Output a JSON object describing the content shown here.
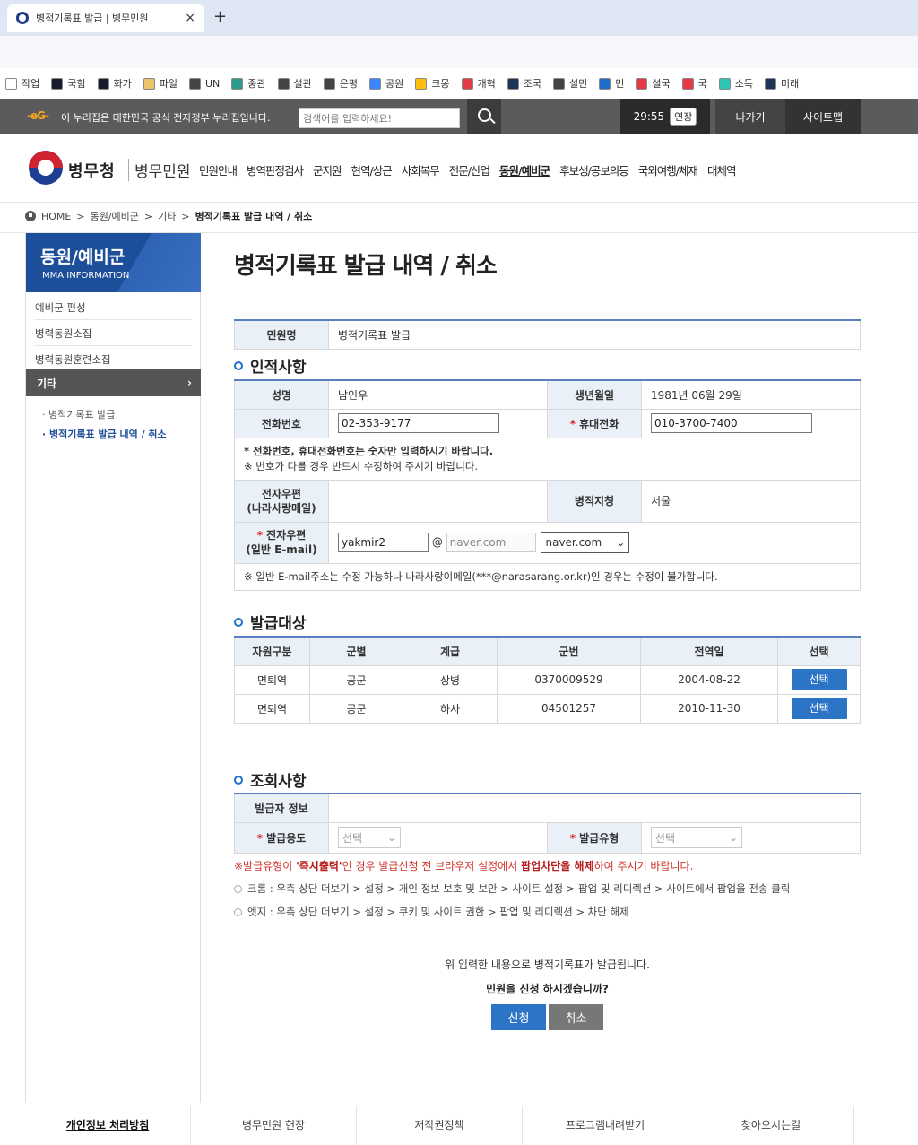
{
  "browser": {
    "tab_title": "병적기록표 발급 | 병무민원",
    "tab_close": "×",
    "new_tab": "+",
    "bookmarks": [
      {
        "label": "작업",
        "color": "#ffffff"
      },
      {
        "label": "국힘",
        "color": "#1a1a2e"
      },
      {
        "label": "화가",
        "color": "#1a1a2e"
      },
      {
        "label": "파일",
        "color": "#e9c46a"
      },
      {
        "label": "UN",
        "color": "#444444"
      },
      {
        "label": "중관",
        "color": "#2a9d8f"
      },
      {
        "label": "설관",
        "color": "#444444"
      },
      {
        "label": "은평",
        "color": "#444444"
      },
      {
        "label": "공원",
        "color": "#3a86ff"
      },
      {
        "label": "크몽",
        "color": "#ffbe0b"
      },
      {
        "label": "개혁",
        "color": "#e63946"
      },
      {
        "label": "조국",
        "color": "#1d3557"
      },
      {
        "label": "설민",
        "color": "#444444"
      },
      {
        "label": "민",
        "color": "#1d6fc9"
      },
      {
        "label": "설국",
        "color": "#e63946"
      },
      {
        "label": "국",
        "color": "#e63946"
      },
      {
        "label": "소득",
        "color": "#2ec4b6"
      },
      {
        "label": "미래",
        "color": "#1d3557"
      }
    ]
  },
  "gov": {
    "logo": "-eG-",
    "text": "이 누리집은 대한민국 공식 전자정부 누리집입니다.",
    "search_placeholder": "검색어를 입력하세요!",
    "timer": "29:55",
    "extend": "연장",
    "logout": "나가기",
    "sitemap": "사이트맵"
  },
  "header": {
    "brand": "병무청",
    "brand2": "병무민원",
    "gnb": [
      "민원안내",
      "병역판정검사",
      "군지원",
      "현역/상근",
      "사회복무",
      "전문/산업",
      "동원/예비군",
      "후보생/공보의등",
      "국외여행/체재",
      "대체역"
    ],
    "active_gnb": "동원/예비군"
  },
  "breadcrumb": {
    "home": "HOME",
    "items": [
      "동원/예비군",
      "기타"
    ],
    "current": "병적기록표 발급 내역 / 취소",
    "sep": ">"
  },
  "lnav": {
    "title": "동원/예비군",
    "subtitle": "MMA INFORMATION",
    "items": [
      "예비군 편성",
      "병력동원소집",
      "병력동원훈련소집"
    ],
    "active": "기타",
    "active_arrow": "›",
    "subs": [
      "병적기록표 발급",
      "병적기록표 발급 내역 / 취소"
    ]
  },
  "page": {
    "title": "병적기록표 발급 내역 / 취소",
    "civil_label": "민원명",
    "civil_value": "병적기록표 발급"
  },
  "personal": {
    "section": "인적사항",
    "name_label": "성명",
    "name": "남인우",
    "birth_label": "생년월일",
    "birth": "1981년 06월 29일",
    "phone_label": "전화번호",
    "phone": "02-353-9177",
    "mobile_label": "휴대전화",
    "mobile": "010-3700-7400",
    "note1": "* 전화번호, 휴대전화번호는 숫자만 입력하시기 바랍니다.",
    "note2": "※ 번호가 다를 경우 반드시 수정하여 주시기 바랍니다.",
    "email1_label1": "전자우편",
    "email1_label2": "(나라사랑메일)",
    "office_label": "병적지청",
    "office": "서울",
    "email2_label1": "전자우편",
    "email2_label2": "(일반 E-mail)",
    "email_id": "yakmir2",
    "at": "@",
    "email_domain": "naver.com",
    "email_select": "naver.com",
    "email_note": "※ 일반 E-mail주소는 수정 가능하나 나라사랑이메일(***@narasarang.or.kr)인 경우는 수정이 불가합니다."
  },
  "target": {
    "section": "발급대상",
    "headers": [
      "자원구분",
      "군별",
      "계급",
      "군번",
      "전역일",
      "선택"
    ],
    "rows": [
      {
        "type": "면퇴역",
        "branch": "공군",
        "rank": "상병",
        "number": "0370009529",
        "date": "2004-08-22",
        "btn": "선택"
      },
      {
        "type": "면퇴역",
        "branch": "공군",
        "rank": "하사",
        "number": "04501257",
        "date": "2010-11-30",
        "btn": "선택"
      }
    ]
  },
  "query": {
    "section": "조회사항",
    "issuer_label": "발급자 정보",
    "purpose_label": "발급용도",
    "purpose": "선택",
    "kind_label": "발급유형",
    "kind": "선택",
    "warn_pre": "※발급유형이 ",
    "warn_b1": "'즉시출력'",
    "warn_mid": "인 경우 발급신청 전 브라우저 설정에서 ",
    "warn_b2": "팝업차단을 해제",
    "warn_post": "하여 주시기 바랍니다.",
    "guide1": "크롬 : 우측 상단 더보기 > 설정 > 개인 정보 보호 및 보안 > 사이트 설정 > 팝업 및 리디렉션 > 사이트에서 팝업을 전송 클릭",
    "guide2": "엣지 : 우측 상단 더보기 > 설정 > 쿠키 및 사이트 권한 > 팝업 및 리디렉션 > 차단 해제"
  },
  "confirm": {
    "line1": "위 입력한 내용으로 병적기록표가 발급됩니다.",
    "line2": "민원을 신청 하시겠습니까?",
    "apply": "신청",
    "cancel": "취소"
  },
  "footer": [
    "개인정보 처리방침",
    "병무민원 헌장",
    "저작권정책",
    "프로그램내려받기",
    "찾아오시는길"
  ]
}
